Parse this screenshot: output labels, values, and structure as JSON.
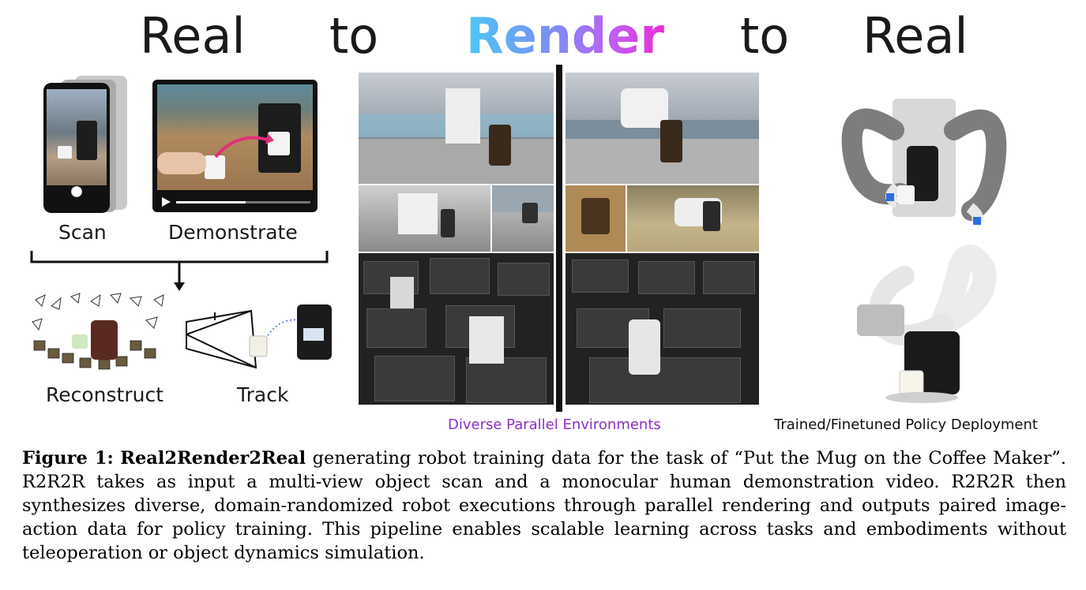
{
  "title": {
    "word1": "Real",
    "word2": "to",
    "word3": "Render",
    "word4": "to",
    "word5": "Real"
  },
  "left_panel": {
    "scan_label": "Scan",
    "demonstrate_label": "Demonstrate",
    "reconstruct_label": "Reconstruct",
    "track_label": "Track"
  },
  "middle_panel": {
    "caption": "Diverse Parallel Environments",
    "caption_color": "#8a2fc7"
  },
  "right_panel": {
    "caption": "Trained/Finetuned Policy Deployment"
  },
  "figure_caption": {
    "label": "Figure 1:",
    "name": "Real2Render2Real",
    "text": " generating robot training data for the task of “Put the Mug on the Coffee Maker”. R2R2R takes as input a multi-view object scan and a monocular human demonstration video. R2R2R then synthesizes diverse, domain-randomized robot executions through parallel rendering and outputs paired image-action data for policy training. This pipeline enables scalable learning across tasks and embodiments without teleoperation or object dynamics simulation."
  },
  "colors": {
    "render_gradient_start": "#4cc7f5",
    "render_gradient_end": "#ee2ad6",
    "demo_arrow": "#e0307a"
  },
  "icons": [
    "shutter-button-icon",
    "play-icon",
    "down-arrow-icon",
    "camera-frustum-icon"
  ]
}
